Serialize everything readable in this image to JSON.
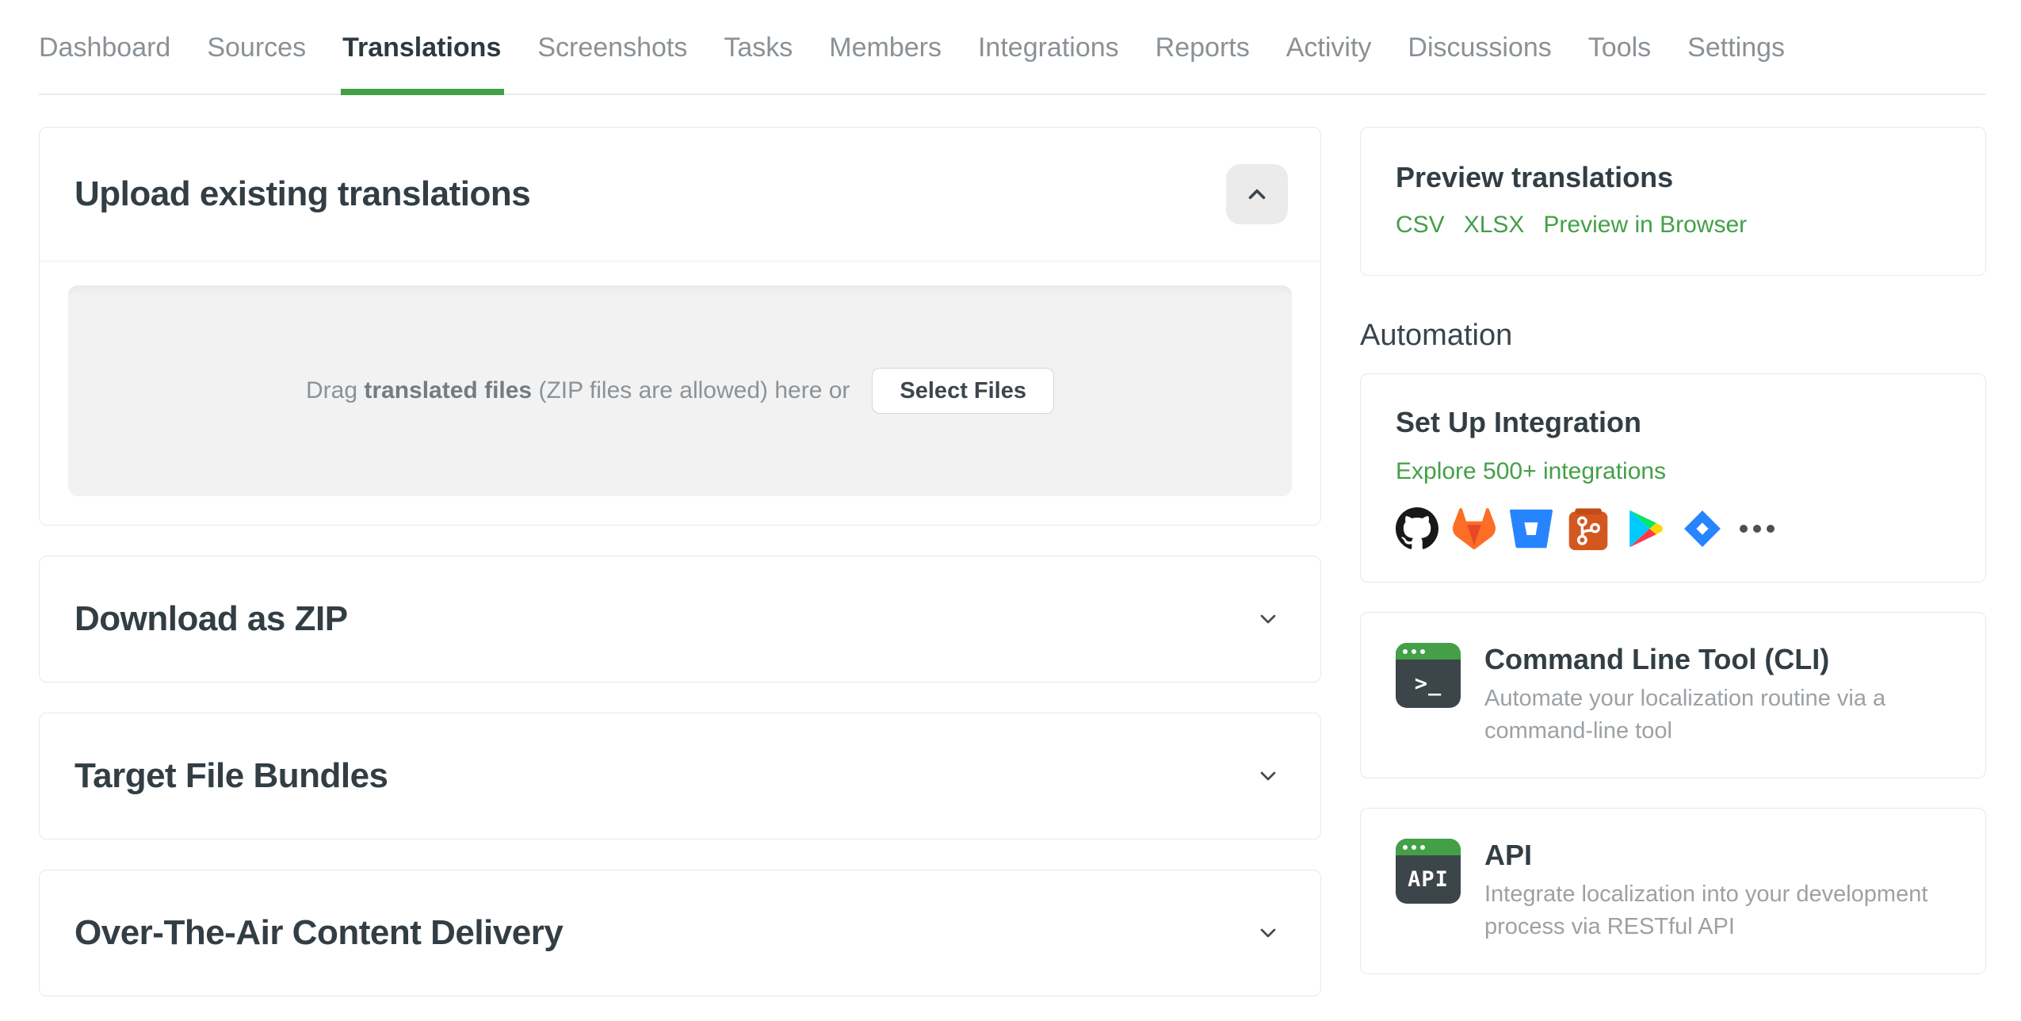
{
  "nav": {
    "tabs": [
      {
        "label": "Dashboard"
      },
      {
        "label": "Sources"
      },
      {
        "label": "Translations"
      },
      {
        "label": "Screenshots"
      },
      {
        "label": "Tasks"
      },
      {
        "label": "Members"
      },
      {
        "label": "Integrations"
      },
      {
        "label": "Reports"
      },
      {
        "label": "Activity"
      },
      {
        "label": "Discussions"
      },
      {
        "label": "Tools"
      },
      {
        "label": "Settings"
      }
    ],
    "active_tab": "Translations"
  },
  "upload_card": {
    "title": "Upload existing translations",
    "collapse_icon": "chevron-up-icon",
    "drag_prefix": "Drag",
    "drag_bold": "translated files",
    "drag_suffix": "(ZIP files are allowed) here or",
    "select_files_label": "Select Files"
  },
  "collapsed_cards": [
    {
      "title": "Download as ZIP"
    },
    {
      "title": "Target File Bundles"
    },
    {
      "title": "Over-The-Air Content Delivery"
    }
  ],
  "sidebar": {
    "preview": {
      "title": "Preview translations",
      "links": [
        {
          "label": "CSV"
        },
        {
          "label": "XLSX"
        },
        {
          "label": "Preview in Browser"
        }
      ]
    },
    "automation_heading": "Automation",
    "integration": {
      "title": "Set Up Integration",
      "explore_link": "Explore 500+ integrations",
      "icons": [
        "github-icon",
        "gitlab-icon",
        "bitbucket-icon",
        "git-icon",
        "google-play-icon",
        "jira-icon",
        "more-integrations-icon"
      ]
    },
    "tools": [
      {
        "icon": "terminal-icon",
        "icon_glyph": ">_",
        "title": "Command Line Tool (CLI)",
        "description": "Automate your localization routine via a command-line tool"
      },
      {
        "icon": "api-icon",
        "icon_glyph": "API",
        "title": "API",
        "description": "Integrate localization into your development process via RESTful API"
      }
    ]
  },
  "colors": {
    "accent_green": "#43a047",
    "active_tab_text": "#2d3a40",
    "inactive_tab_text": "#8a9196",
    "title_text": "#323e44",
    "description_text": "#9ca1a5",
    "card_border": "#e6e8e9",
    "dropzone_bg": "#f2f2f3"
  }
}
